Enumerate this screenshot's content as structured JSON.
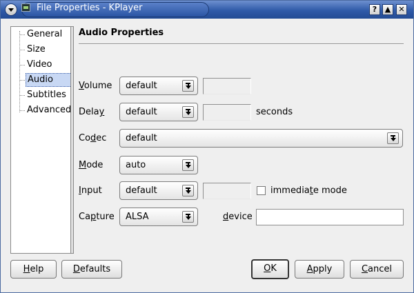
{
  "window": {
    "title": "File Properties - KPlayer",
    "buttons": {
      "help": "?",
      "maximize": "▲",
      "close": "✕"
    }
  },
  "sidebar": {
    "items": [
      {
        "label": "General",
        "selected": false
      },
      {
        "label": "Size",
        "selected": false
      },
      {
        "label": "Video",
        "selected": false
      },
      {
        "label": "Audio",
        "selected": true
      },
      {
        "label": "Subtitles",
        "selected": false
      },
      {
        "label": "Advanced",
        "selected": false
      }
    ]
  },
  "audio": {
    "heading": "Audio Properties",
    "volume": {
      "mn": "V",
      "rest": "olume",
      "value": "default"
    },
    "delay": {
      "pre": "Dela",
      "mn": "y",
      "value": "default",
      "unit": "seconds"
    },
    "codec": {
      "pre": "Co",
      "mn": "d",
      "rest": "ec",
      "value": "default"
    },
    "mode": {
      "mn": "M",
      "rest": "ode",
      "value": "auto"
    },
    "input": {
      "mn": "I",
      "rest": "nput",
      "value": "default",
      "immediate_pre": "immedia",
      "immediate_mn": "t",
      "immediate_rest": "e mode",
      "immediate_checked": false
    },
    "capture": {
      "pre": "Ca",
      "mn": "p",
      "rest": "ture",
      "value": "ALSA",
      "device_mn": "d",
      "device_rest": "evice",
      "device_value": ""
    }
  },
  "footer": {
    "help": {
      "mn": "H",
      "rest": "elp"
    },
    "defaults": {
      "mn": "D",
      "rest": "efaults"
    },
    "ok": {
      "mn": "O",
      "rest": "K"
    },
    "apply": {
      "mn": "A",
      "rest": "pply"
    },
    "cancel": {
      "mn": "C",
      "rest": "ancel"
    }
  }
}
